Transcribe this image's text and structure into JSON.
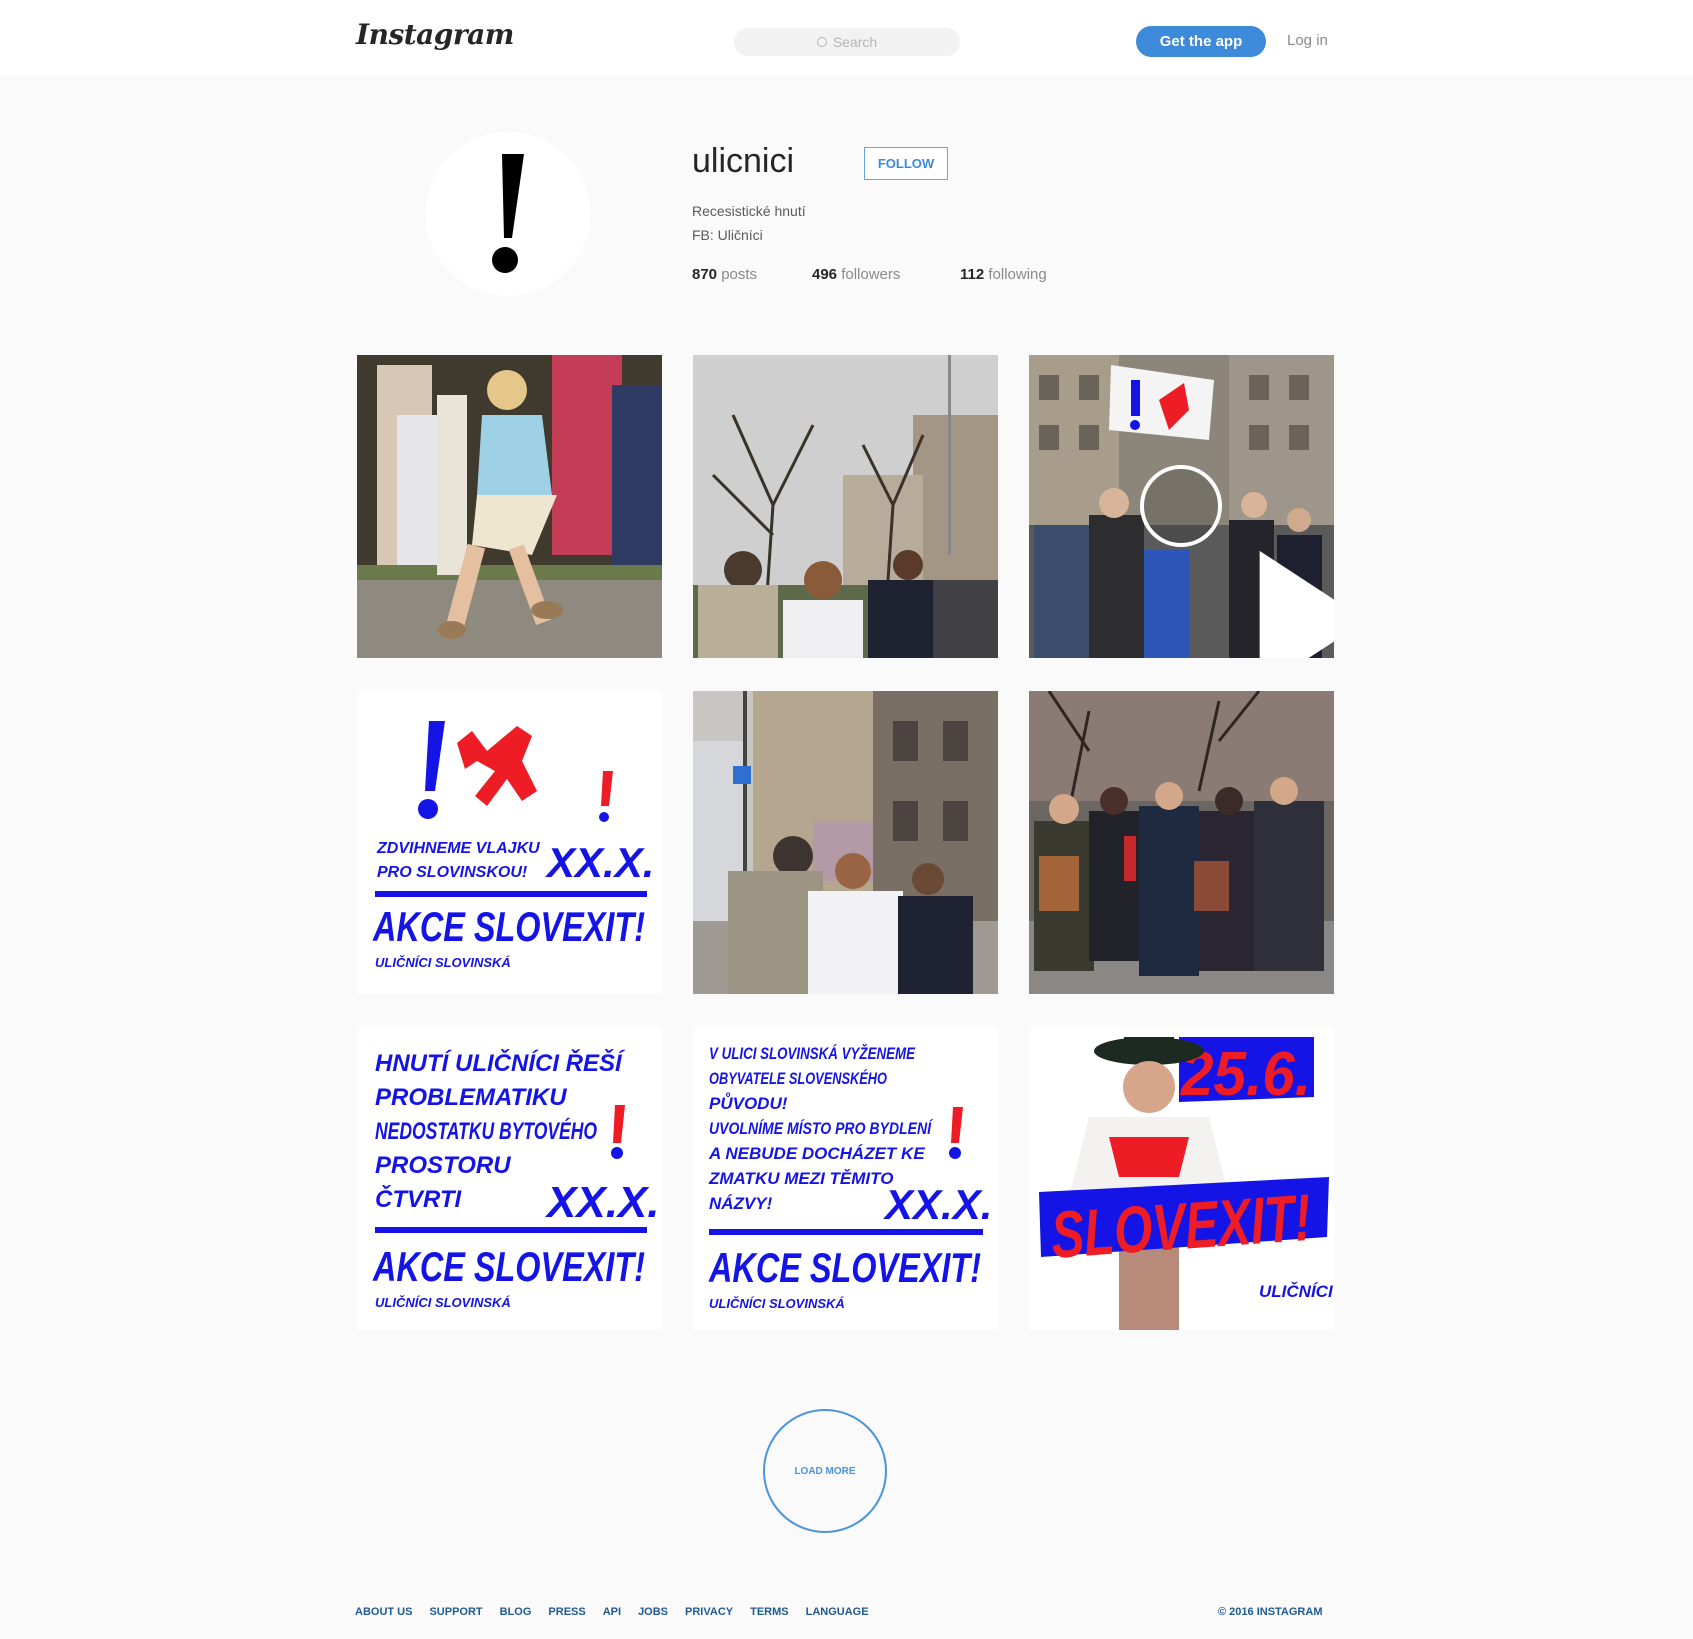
{
  "header": {
    "logo": "Instagram",
    "search_placeholder": "Search",
    "get_app_label": "Get the app",
    "login_label": "Log in"
  },
  "profile": {
    "username": "ulicnici",
    "follow_label": "FOLLOW",
    "bio_line1": "Recesistické hnutí",
    "bio_line2": "FB: Uličníci",
    "stats": {
      "posts_count": "870",
      "posts_label": "posts",
      "followers_count": "496",
      "followers_label": "followers",
      "following_count": "112",
      "following_label": "following"
    }
  },
  "posts": {
    "poster1": {
      "line1": "ZDVIHNEME VLAJKU",
      "line2": "PRO SLOVINSKOU!",
      "date": "XX.X.",
      "headline": "AKCE SLOVEXIT!",
      "signature": "ULIČNÍCI SLOVINSKÁ"
    },
    "poster2": {
      "lines": [
        "HNUTÍ ULIČNÍCI ŘEŠÍ",
        "PROBLEMATIKU",
        "NEDOSTATKU BYTOVÉHO",
        "PROSTORU",
        "ČTVRTI"
      ],
      "date": "XX.X.",
      "headline": "AKCE SLOVEXIT!",
      "signature": "ULIČNÍCI SLOVINSKÁ"
    },
    "poster3": {
      "lines": [
        "V ULICI SLOVINSKÁ VYŽENEME",
        "OBYVATELE SLOVENSKÉHO",
        "PŮVODU!",
        "UVOLNÍME MÍSTO PRO BYDLENÍ",
        "A NEBUDE DOCHÁZET KE",
        "ZMATKU MEZI TĚMITO",
        "NÁZVY!"
      ],
      "date": "XX.X.",
      "headline": "AKCE SLOVEXIT!",
      "signature": "ULIČNÍCI SLOVINSKÁ"
    },
    "poster4": {
      "date": "25.6.",
      "headline": "SLOVEXIT!",
      "signature": "ULIČNÍCI"
    }
  },
  "load_more_label": "LOAD MORE",
  "footer": {
    "links": [
      "ABOUT US",
      "SUPPORT",
      "BLOG",
      "PRESS",
      "API",
      "JOBS",
      "PRIVACY",
      "TERMS",
      "LANGUAGE"
    ],
    "copyright": "© 2016 INSTAGRAM"
  },
  "colors": {
    "accent": "#3c8ad9",
    "poster_blue": "#1414e6",
    "poster_red": "#ee1c25"
  }
}
